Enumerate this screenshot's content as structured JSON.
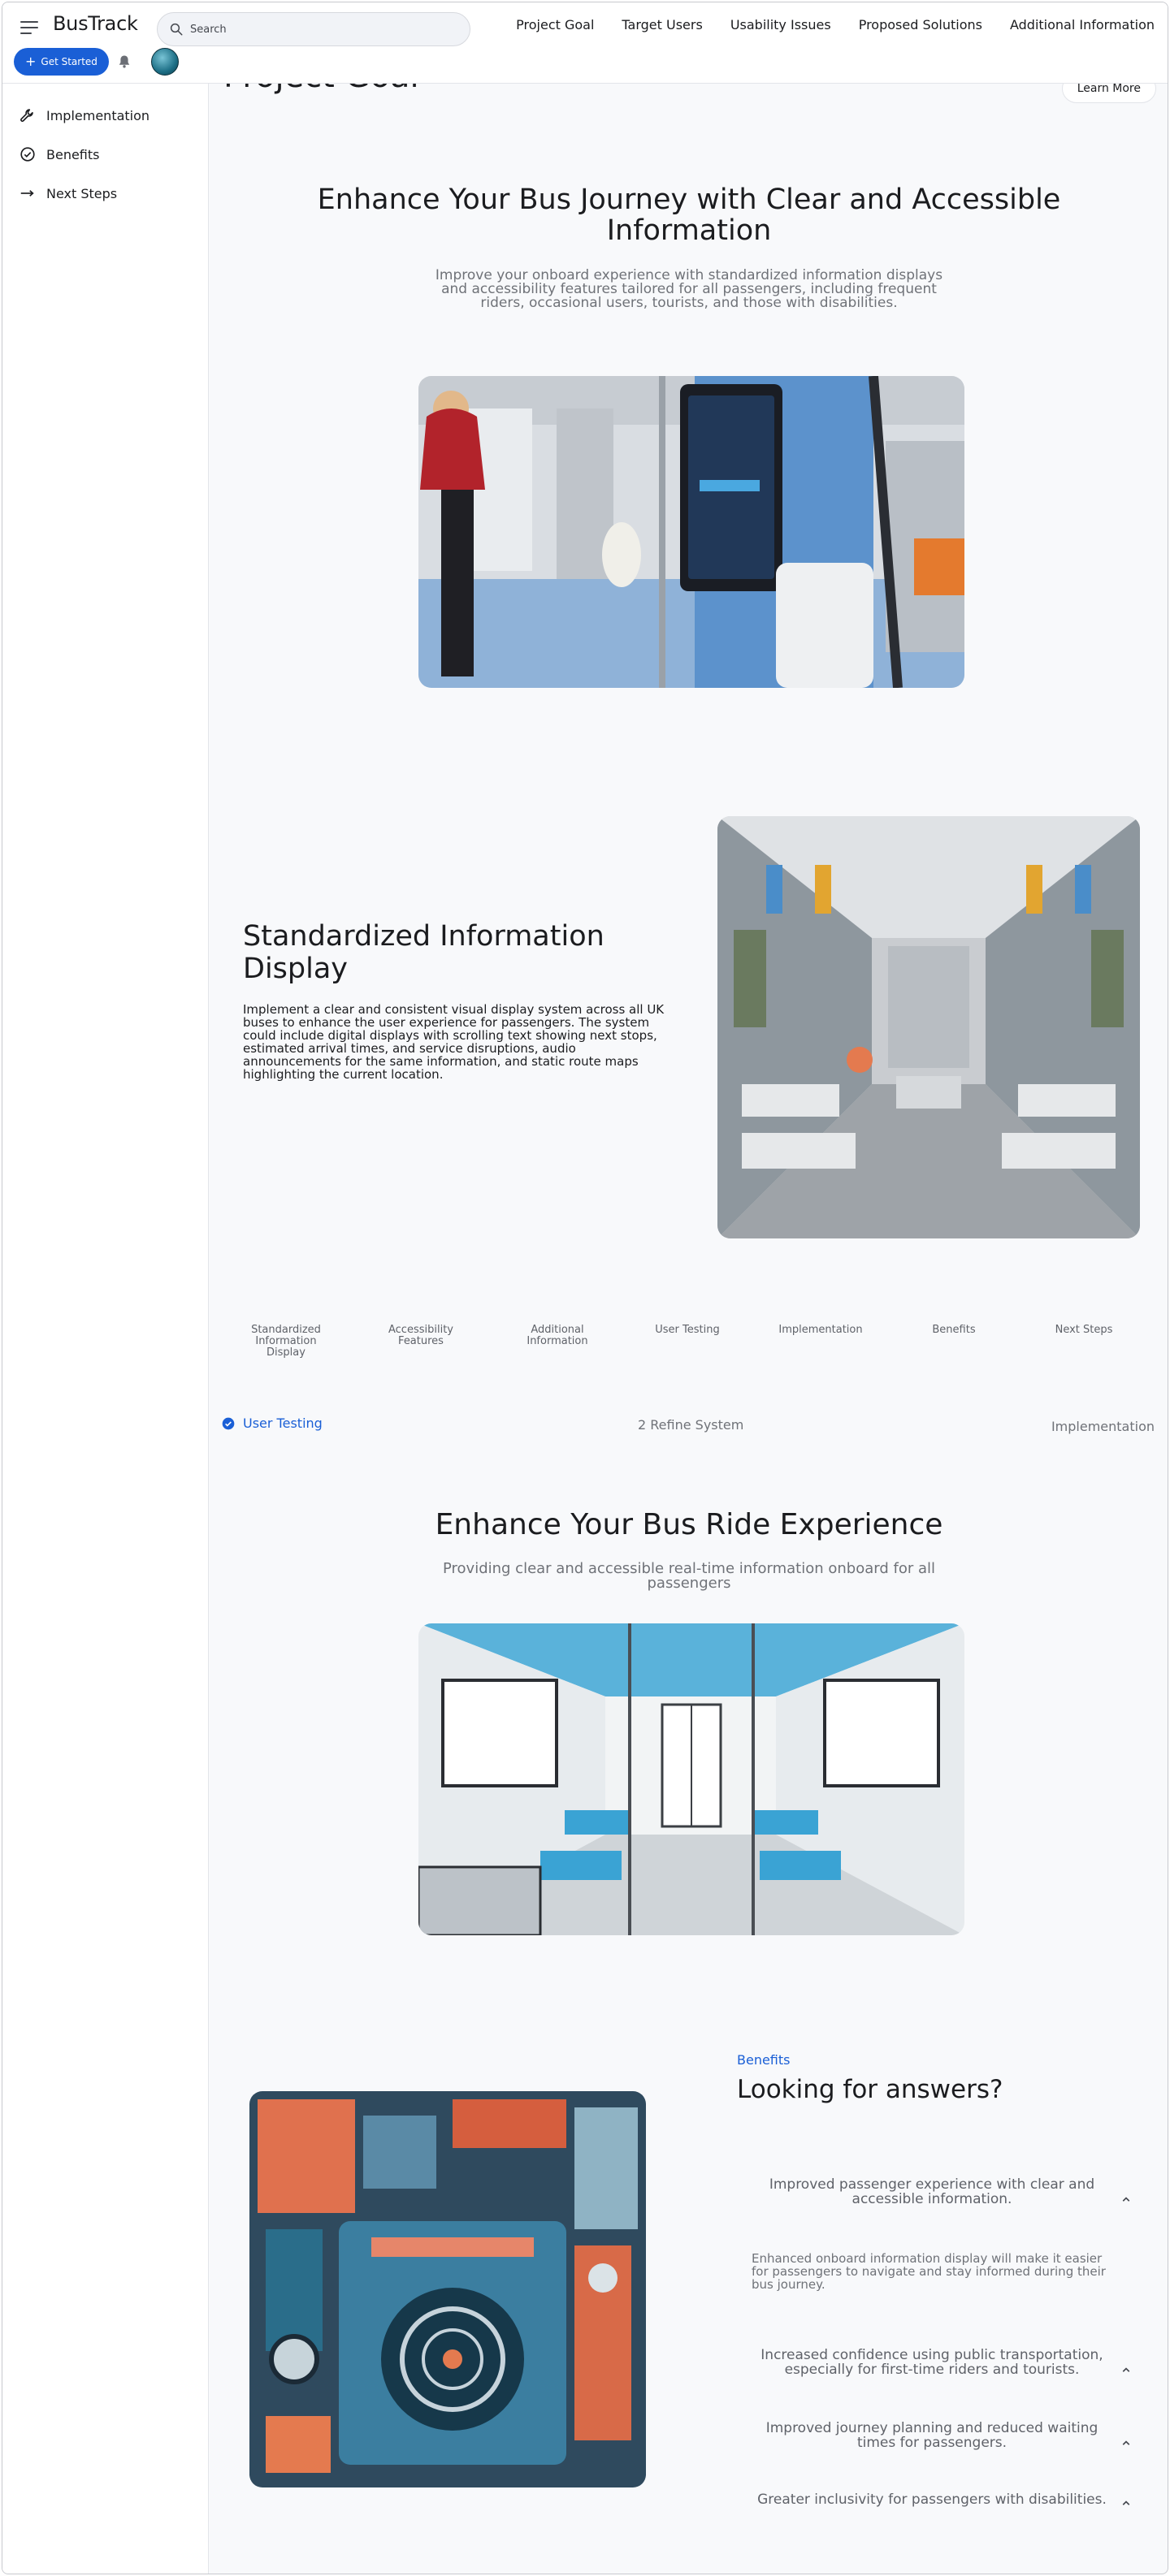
{
  "header": {
    "brand": "BusTrack",
    "search_placeholder": "Search",
    "nav": [
      "Project Goal",
      "Target Users",
      "Usability Issues",
      "Proposed Solutions",
      "Additional Information"
    ],
    "cta_label": "Get Started"
  },
  "sidebar": {
    "items": [
      {
        "label": "Implementation",
        "icon": "wrench-icon"
      },
      {
        "label": "Benefits",
        "icon": "check-circle-icon"
      },
      {
        "label": "Next Steps",
        "icon": "arrow-right-icon"
      }
    ]
  },
  "main": {
    "peek_title": "Project Goal",
    "learn_more": "Learn More",
    "hero": {
      "title_line1": "Enhance Your Bus Journey with Clear and Accessible",
      "title_line2": "Information",
      "sub_line1": "Improve your onboard experience with standardized information displays",
      "sub_line2": "and accessibility features tailored for all passengers, including frequent",
      "sub_line3": "riders, occasional users, tourists, and those with disabilities."
    },
    "feature": {
      "title_line1": "Standardized Information",
      "title_line2": "Display",
      "desc_line1": "Implement a clear and consistent visual display system across all UK",
      "desc_line2": "buses to enhance the user experience for passengers. The system",
      "desc_line3": "could include digital displays with scrolling text showing next stops,",
      "desc_line4": "estimated arrival times, and service disruptions, audio",
      "desc_line5": "announcements for the same information, and static route maps",
      "desc_line6": "highlighting the current location."
    },
    "tabs": [
      {
        "line1": "Standardized",
        "line2": "Information",
        "line3": "Display"
      },
      {
        "line1": "Accessibility",
        "line2": "Features",
        "line3": ""
      },
      {
        "line1": "Additional",
        "line2": "Information",
        "line3": ""
      },
      {
        "line1": "User Testing",
        "line2": "",
        "line3": ""
      },
      {
        "line1": "Implementation",
        "line2": "",
        "line3": ""
      },
      {
        "line1": "Benefits",
        "line2": "",
        "line3": ""
      },
      {
        "line1": "Next Steps",
        "line2": "",
        "line3": ""
      }
    ],
    "stepper": {
      "active": "User Testing",
      "middle": "2 Refine System",
      "right": "Implementation"
    },
    "ride": {
      "title": "Enhance Your Bus Ride Experience",
      "sub_line1": "Providing clear and accessible real-time information onboard for all",
      "sub_line2": "passengers"
    },
    "faq": {
      "kicker": "Benefits",
      "title": "Looking for answers?",
      "items": [
        {
          "q_line1": "Improved passenger experience with clear and",
          "q_line2": "accessible information.",
          "answer_line1": "Enhanced onboard information display will make it easier",
          "answer_line2": "for passengers to navigate and stay informed during their",
          "answer_line3": "bus journey."
        },
        {
          "q_line1": "Increased confidence using public transportation,",
          "q_line2": "especially for first-time riders and tourists."
        },
        {
          "q_line1": "Improved journey planning and reduced waiting",
          "q_line2": "times for passengers."
        },
        {
          "q_line1": "Greater inclusivity for passengers with disabilities.",
          "q_line2": ""
        }
      ]
    }
  },
  "colors": {
    "accent": "#1a5fd6",
    "page_bg": "#f8f9fb",
    "text": "#1b1c1f",
    "muted": "#6f7278"
  }
}
